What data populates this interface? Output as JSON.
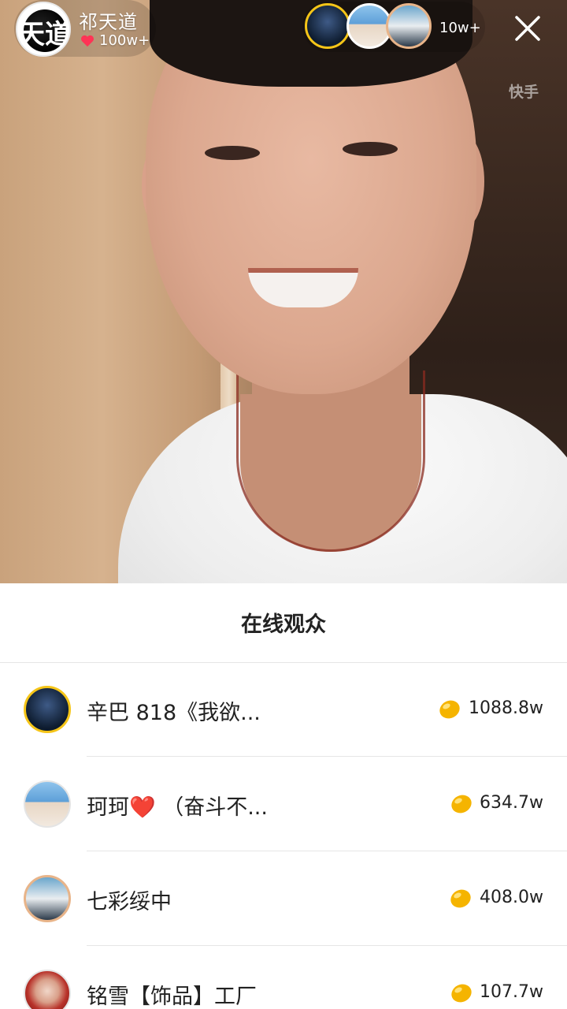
{
  "anchor": {
    "name": "祁天道",
    "avatar_text": "天道",
    "likes": "100w+"
  },
  "top_bar": {
    "viewer_count": "10w+",
    "watermark": "快手",
    "icons": {
      "close": "close-icon",
      "like": "heart-icon"
    }
  },
  "sheet": {
    "title": "在线观众",
    "viewers": [
      {
        "name": "辛巴 818《我欲...",
        "amount": "1088.8w"
      },
      {
        "name": "珂珂❤️ （奋斗不...",
        "amount": "634.7w"
      },
      {
        "name": "七彩绥中",
        "amount": "408.0w"
      },
      {
        "name": "铭雪【饰品】工厂",
        "amount": "107.7w"
      }
    ]
  },
  "colors": {
    "sheet_bg": "#ffffff",
    "text": "#222222",
    "coin": "#f5b400",
    "gold_ring": "#f5c518",
    "heart": "#ff3355"
  }
}
